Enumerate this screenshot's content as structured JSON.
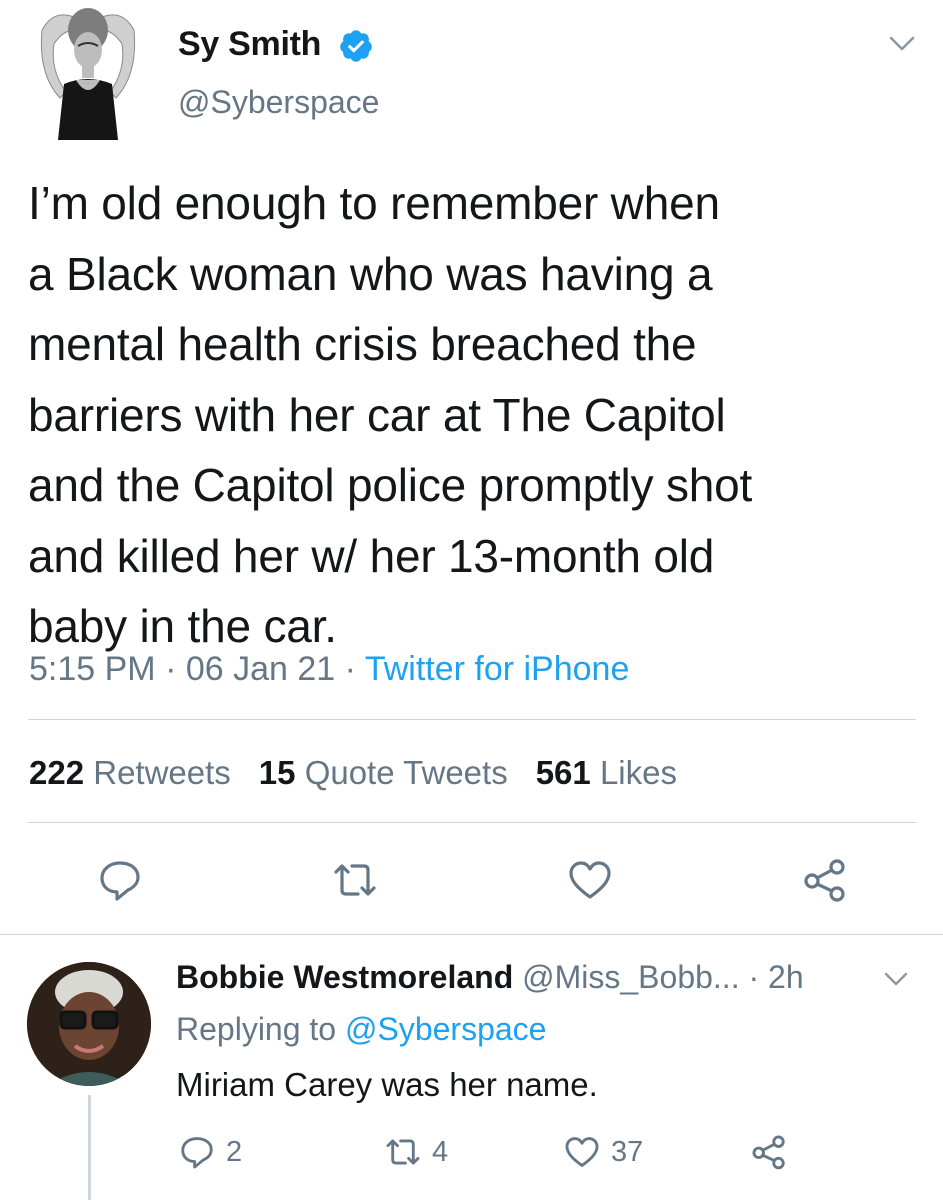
{
  "tweet": {
    "author_name": "Sy Smith",
    "author_handle": "@Syberspace",
    "text_lines": [
      "I’m old enough to remember when",
      "a Black woman who was having a",
      "mental health crisis breached the",
      "barriers with her car at The Capitol",
      "and the Capitol police promptly shot",
      "and killed her w/ her 13-month old",
      "baby in the car."
    ],
    "time": "5:15 PM",
    "date": "06 Jan 21",
    "source": "Twitter for iPhone",
    "sep": " · "
  },
  "stats": {
    "retweets_count": "222",
    "retweets_label": "Retweets",
    "quotes_count": "15",
    "quotes_label": "Quote Tweets",
    "likes_count": "561",
    "likes_label": "Likes"
  },
  "reply": {
    "name": "Bobbie Westmoreland",
    "handle": "@Miss_Bobb...",
    "time": "· 2h",
    "replying_prefix": "Replying to",
    "replying_mention": "@Syberspace",
    "text": "Miriam Carey was her name.",
    "reply_count": "2",
    "retweet_count": "4",
    "like_count": "37"
  },
  "colors": {
    "link": "#1da1f2",
    "secondary": "#657786",
    "primary_text": "#14171a",
    "verified_badge": "#1da1f2"
  },
  "icons": [
    "verified-badge-icon",
    "chevron-down-icon",
    "reply-icon",
    "retweet-icon",
    "like-icon",
    "share-icon"
  ]
}
